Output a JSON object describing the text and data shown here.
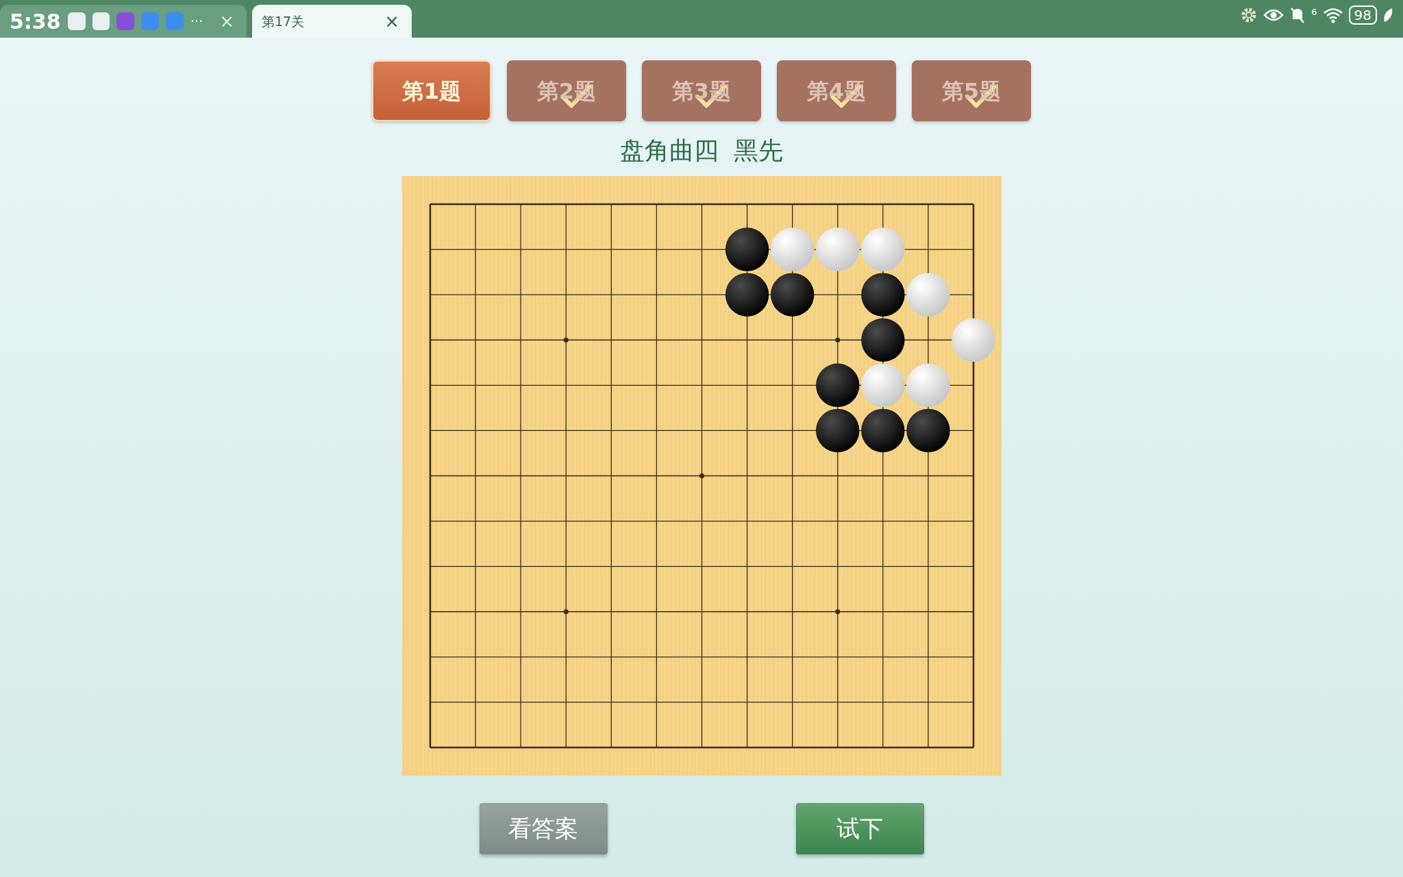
{
  "top_bar": {
    "clock": "5:38",
    "more": "···",
    "tabs": [
      {
        "selected": false,
        "close": "×"
      },
      {
        "label": "第17关",
        "selected": true,
        "close": "×"
      }
    ],
    "wifi_label": "6",
    "battery": "98"
  },
  "problems": [
    {
      "label": "第1题",
      "selected": true,
      "completed": false
    },
    {
      "label": "第2题",
      "selected": false,
      "completed": true
    },
    {
      "label": "第3题",
      "selected": false,
      "completed": true
    },
    {
      "label": "第4题",
      "selected": false,
      "completed": true
    },
    {
      "label": "第5题",
      "selected": false,
      "completed": true
    }
  ],
  "title": "盘角曲四  黑先",
  "board": {
    "rows": [
      [
        {
          "kind": "empty"
        },
        {
          "kind": "empty"
        },
        {
          "kind": "empty"
        },
        {
          "kind": "empty"
        },
        {
          "kind": "empty"
        },
        {
          "kind": "empty"
        },
        {
          "kind": "empty"
        },
        {
          "kind": "empty"
        },
        {
          "kind": "empty"
        },
        {
          "kind": "empty"
        },
        {
          "kind": "empty"
        },
        {
          "kind": "empty"
        },
        {
          "kind": "empty"
        }
      ],
      [
        {
          "kind": "empty"
        },
        {
          "kind": "empty"
        },
        {
          "kind": "empty"
        },
        {
          "kind": "empty"
        },
        {
          "kind": "empty"
        },
        {
          "kind": "empty"
        },
        {
          "kind": "empty"
        },
        {
          "kind": "black"
        },
        {
          "kind": "white"
        },
        {
          "kind": "white"
        },
        {
          "kind": "white"
        },
        {
          "kind": "empty"
        },
        {
          "kind": "empty"
        }
      ],
      [
        {
          "kind": "empty"
        },
        {
          "kind": "empty"
        },
        {
          "kind": "empty"
        },
        {
          "kind": "empty"
        },
        {
          "kind": "empty"
        },
        {
          "kind": "empty"
        },
        {
          "kind": "empty"
        },
        {
          "kind": "black"
        },
        {
          "kind": "black"
        },
        {
          "kind": "empty"
        },
        {
          "kind": "black"
        },
        {
          "kind": "white"
        },
        {
          "kind": "empty"
        }
      ],
      [
        {
          "kind": "empty"
        },
        {
          "kind": "empty"
        },
        {
          "kind": "empty"
        },
        {
          "kind": "empty"
        },
        {
          "kind": "empty"
        },
        {
          "kind": "empty"
        },
        {
          "kind": "empty"
        },
        {
          "kind": "empty"
        },
        {
          "kind": "empty"
        },
        {
          "kind": "empty"
        },
        {
          "kind": "black"
        },
        {
          "kind": "empty"
        },
        {
          "kind": "white"
        }
      ],
      [
        {
          "kind": "empty"
        },
        {
          "kind": "empty"
        },
        {
          "kind": "empty"
        },
        {
          "kind": "empty"
        },
        {
          "kind": "empty"
        },
        {
          "kind": "empty"
        },
        {
          "kind": "empty"
        },
        {
          "kind": "empty"
        },
        {
          "kind": "empty"
        },
        {
          "kind": "black"
        },
        {
          "kind": "white"
        },
        {
          "kind": "white"
        },
        {
          "kind": "empty"
        }
      ],
      [
        {
          "kind": "empty"
        },
        {
          "kind": "empty"
        },
        {
          "kind": "empty"
        },
        {
          "kind": "empty"
        },
        {
          "kind": "empty"
        },
        {
          "kind": "empty"
        },
        {
          "kind": "empty"
        },
        {
          "kind": "empty"
        },
        {
          "kind": "empty"
        },
        {
          "kind": "black"
        },
        {
          "kind": "black"
        },
        {
          "kind": "black"
        },
        {
          "kind": "empty"
        }
      ],
      [
        {
          "kind": "empty"
        },
        {
          "kind": "empty"
        },
        {
          "kind": "empty"
        },
        {
          "kind": "empty"
        },
        {
          "kind": "empty"
        },
        {
          "kind": "empty"
        },
        {
          "kind": "empty"
        },
        {
          "kind": "empty"
        },
        {
          "kind": "empty"
        },
        {
          "kind": "empty"
        },
        {
          "kind": "empty"
        },
        {
          "kind": "empty"
        },
        {
          "kind": "empty"
        }
      ],
      [
        {
          "kind": "empty"
        },
        {
          "kind": "empty"
        },
        {
          "kind": "empty"
        },
        {
          "kind": "empty"
        },
        {
          "kind": "empty"
        },
        {
          "kind": "empty"
        },
        {
          "kind": "empty"
        },
        {
          "kind": "empty"
        },
        {
          "kind": "empty"
        },
        {
          "kind": "empty"
        },
        {
          "kind": "empty"
        },
        {
          "kind": "empty"
        },
        {
          "kind": "empty"
        }
      ],
      [
        {
          "kind": "empty"
        },
        {
          "kind": "empty"
        },
        {
          "kind": "empty"
        },
        {
          "kind": "empty"
        },
        {
          "kind": "empty"
        },
        {
          "kind": "empty"
        },
        {
          "kind": "empty"
        },
        {
          "kind": "empty"
        },
        {
          "kind": "empty"
        },
        {
          "kind": "empty"
        },
        {
          "kind": "empty"
        },
        {
          "kind": "empty"
        },
        {
          "kind": "empty"
        }
      ],
      [
        {
          "kind": "empty"
        },
        {
          "kind": "empty"
        },
        {
          "kind": "empty"
        },
        {
          "kind": "empty"
        },
        {
          "kind": "empty"
        },
        {
          "kind": "empty"
        },
        {
          "kind": "empty"
        },
        {
          "kind": "empty"
        },
        {
          "kind": "empty"
        },
        {
          "kind": "empty"
        },
        {
          "kind": "empty"
        },
        {
          "kind": "empty"
        },
        {
          "kind": "empty"
        }
      ],
      [
        {
          "kind": "empty"
        },
        {
          "kind": "empty"
        },
        {
          "kind": "empty"
        },
        {
          "kind": "empty"
        },
        {
          "kind": "empty"
        },
        {
          "kind": "empty"
        },
        {
          "kind": "empty"
        },
        {
          "kind": "empty"
        },
        {
          "kind": "empty"
        },
        {
          "kind": "empty"
        },
        {
          "kind": "empty"
        },
        {
          "kind": "empty"
        },
        {
          "kind": "empty"
        }
      ],
      [
        {
          "kind": "empty"
        },
        {
          "kind": "empty"
        },
        {
          "kind": "empty"
        },
        {
          "kind": "empty"
        },
        {
          "kind": "empty"
        },
        {
          "kind": "empty"
        },
        {
          "kind": "empty"
        },
        {
          "kind": "empty"
        },
        {
          "kind": "empty"
        },
        {
          "kind": "empty"
        },
        {
          "kind": "empty"
        },
        {
          "kind": "empty"
        },
        {
          "kind": "empty"
        }
      ],
      [
        {
          "kind": "empty"
        },
        {
          "kind": "empty"
        },
        {
          "kind": "empty"
        },
        {
          "kind": "empty"
        },
        {
          "kind": "empty"
        },
        {
          "kind": "empty"
        },
        {
          "kind": "empty"
        },
        {
          "kind": "empty"
        },
        {
          "kind": "empty"
        },
        {
          "kind": "empty"
        },
        {
          "kind": "empty"
        },
        {
          "kind": "empty"
        },
        {
          "kind": "empty"
        }
      ]
    ]
  },
  "buttons": [
    {
      "label": "看答案",
      "kind": "secondary"
    },
    {
      "label": "试下",
      "kind": "primary"
    }
  ]
}
